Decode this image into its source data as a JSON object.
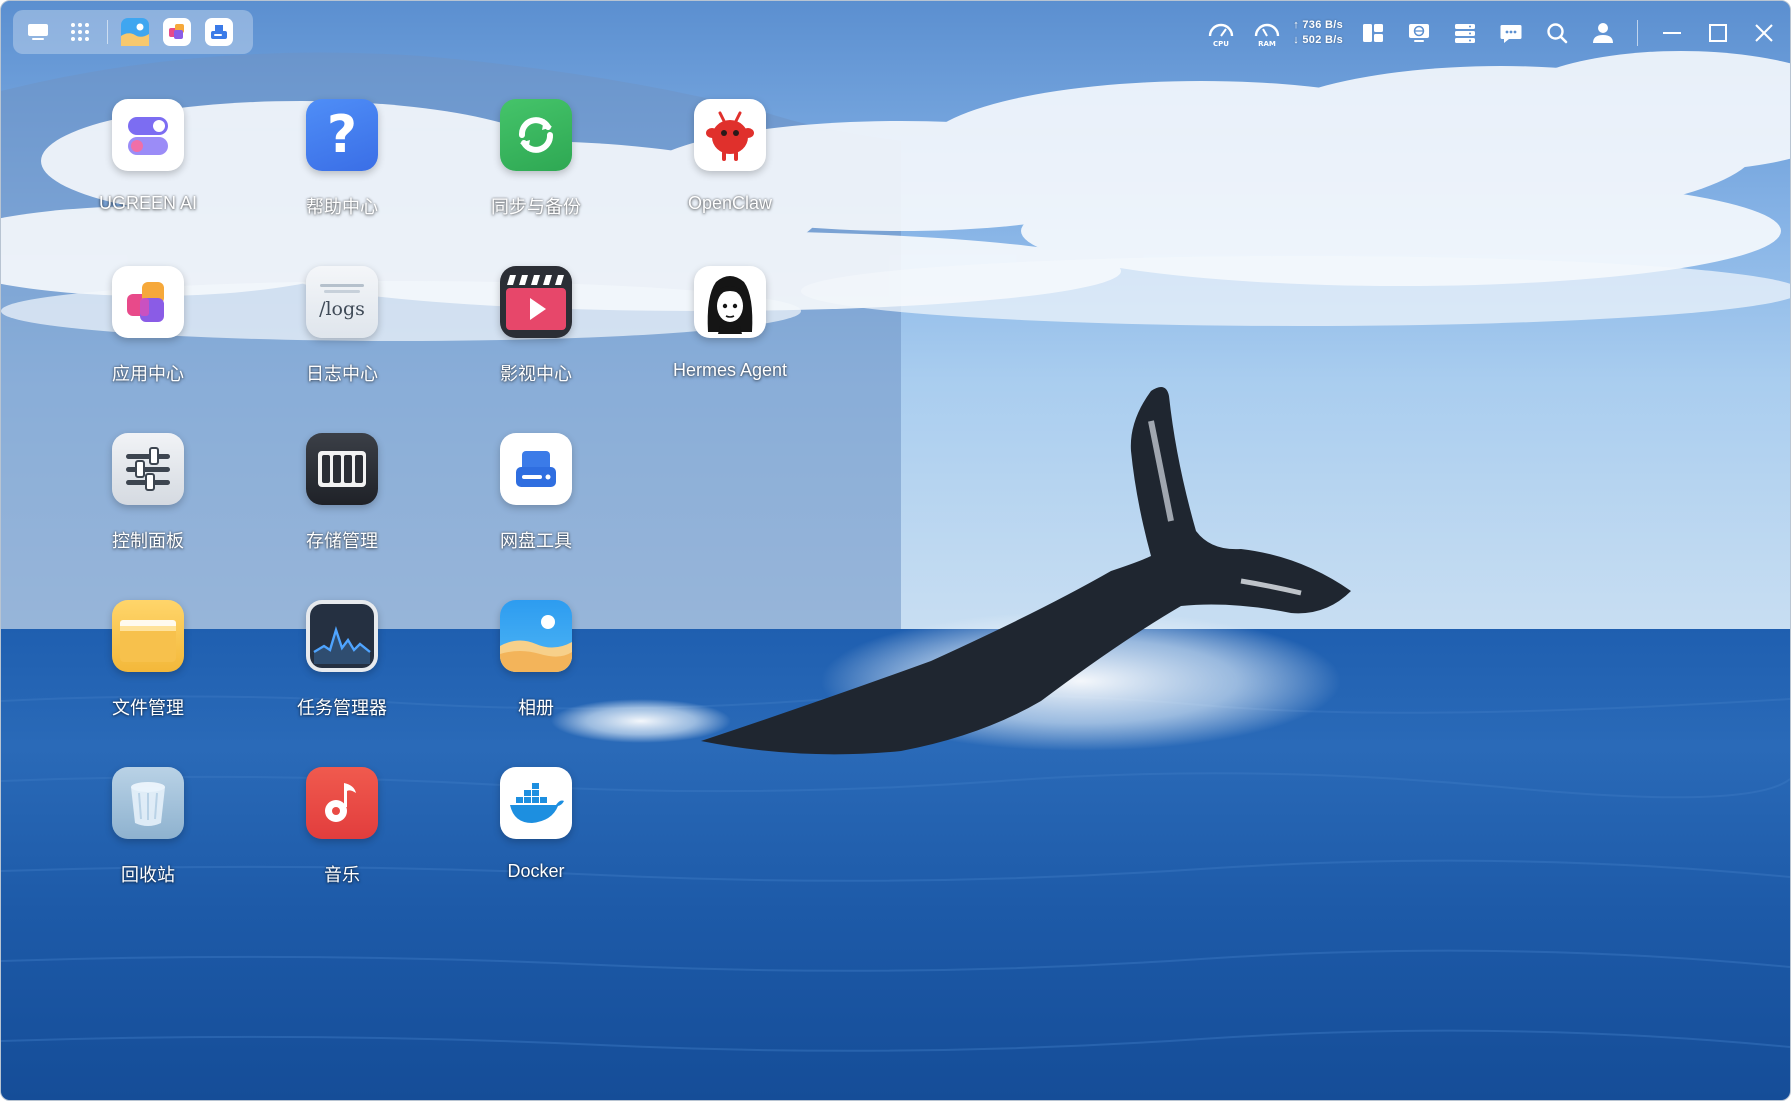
{
  "dock": {
    "items": [
      {
        "name": "show-desktop",
        "icon": "monitor-icon"
      },
      {
        "name": "app-launcher",
        "icon": "grid-icon"
      },
      {
        "name": "photos-app",
        "icon": "photos-icon"
      },
      {
        "name": "app-center",
        "icon": "app-center-icon"
      },
      {
        "name": "disk-tool",
        "icon": "disk-tool-icon"
      }
    ]
  },
  "toolbar": {
    "cpu_label": "CPU",
    "ram_label": "RAM",
    "upload_speed": "↑ 736 B/s",
    "download_speed": "↓ 502 B/s"
  },
  "apps": [
    {
      "label": "UGREEN AI",
      "icon": "ugreen-ai-icon"
    },
    {
      "label": "帮助中心",
      "icon": "help-icon"
    },
    {
      "label": "同步与备份",
      "icon": "sync-icon"
    },
    {
      "label": "OpenClaw",
      "icon": "openclaw-icon"
    },
    {
      "label": "应用中心",
      "icon": "app-center-icon"
    },
    {
      "label": "日志中心",
      "icon": "logs-icon",
      "glyph": "/logs"
    },
    {
      "label": "影视中心",
      "icon": "video-icon"
    },
    {
      "label": "Hermes Agent",
      "icon": "hermes-icon"
    },
    {
      "label": "控制面板",
      "icon": "control-panel-icon"
    },
    {
      "label": "存储管理",
      "icon": "storage-icon"
    },
    {
      "label": "网盘工具",
      "icon": "disk-tool-icon"
    },
    {
      "label": "文件管理",
      "icon": "folder-icon"
    },
    {
      "label": "任务管理器",
      "icon": "task-manager-icon"
    },
    {
      "label": "相册",
      "icon": "photos-icon"
    },
    {
      "label": "回收站",
      "icon": "trash-icon"
    },
    {
      "label": "音乐",
      "icon": "music-icon"
    },
    {
      "label": "Docker",
      "icon": "docker-icon"
    }
  ]
}
